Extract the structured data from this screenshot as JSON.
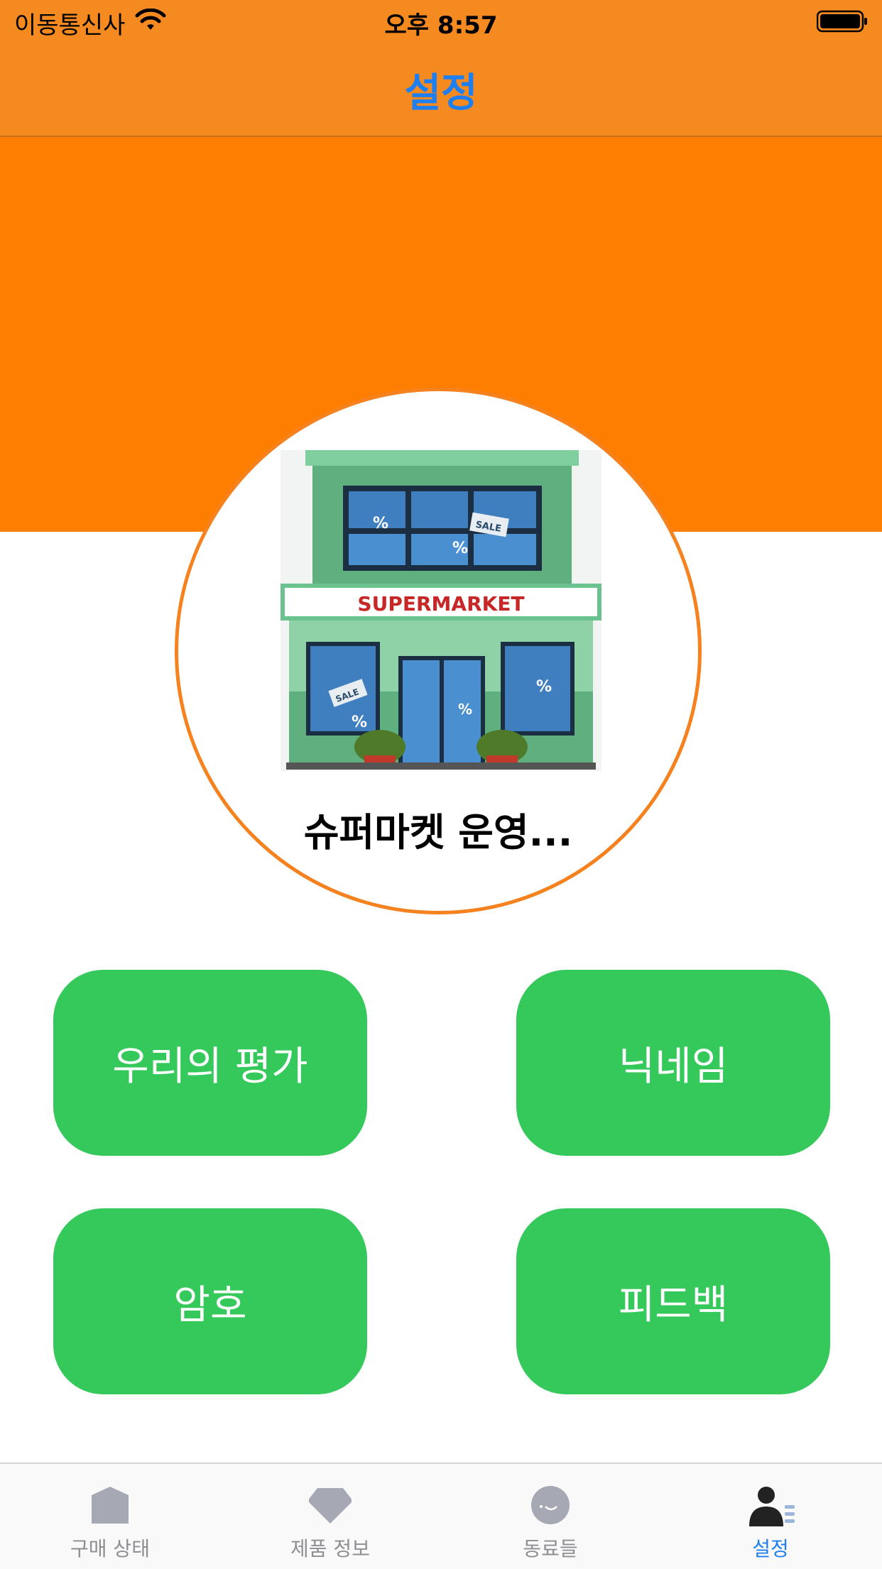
{
  "status_bar": {
    "carrier": "이동통신사",
    "time": "오후 8:57"
  },
  "nav": {
    "title": "설정"
  },
  "profile": {
    "name": "슈퍼마켓 운영...",
    "image_sign_text": "SUPERMARKET",
    "image_tag_text": "SALE"
  },
  "buttons": {
    "rating": "우리의 평가",
    "nickname": "닉네임",
    "password": "암호",
    "feedback": "피드백"
  },
  "tabs": [
    {
      "label": "구매 상태",
      "icon": "house-icon"
    },
    {
      "label": "제품 정보",
      "icon": "diamond-icon"
    },
    {
      "label": "동료들",
      "icon": "face-icon"
    },
    {
      "label": "설정",
      "icon": "person-list-icon"
    }
  ],
  "colors": {
    "header": "#f58a20",
    "hero": "#fd7e00",
    "accent": "#1e7ff0",
    "button": "#35c95b"
  }
}
